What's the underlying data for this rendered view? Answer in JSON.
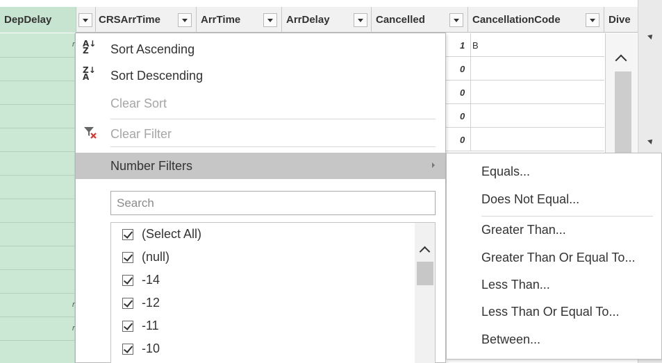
{
  "columns": [
    {
      "label": "DepDelay"
    },
    {
      "label": "CRSArrTime"
    },
    {
      "label": "ArrTime"
    },
    {
      "label": "ArrDelay"
    },
    {
      "label": "Cancelled"
    },
    {
      "label": "CancellationCode"
    },
    {
      "label": "Dive"
    }
  ],
  "grid": {
    "cancelled_values": [
      "1",
      "0",
      "0",
      "0",
      "0"
    ],
    "cancellation_codes": [
      "B",
      "",
      "",
      "",
      ""
    ],
    "depdelay_marks": [
      "r",
      "r",
      "r"
    ]
  },
  "menu": {
    "sort_ascending": "Sort Ascending",
    "sort_descending": "Sort Descending",
    "clear_sort": "Clear Sort",
    "clear_filter": "Clear Filter",
    "number_filters": "Number Filters",
    "search_placeholder": "Search",
    "checklist": [
      "(Select All)",
      "(null)",
      "-14",
      "-12",
      "-11",
      "-10"
    ]
  },
  "submenu": {
    "items": [
      "Equals...",
      "Does Not Equal...",
      "Greater Than...",
      "Greater Than Or Equal To...",
      "Less Than...",
      "Less Than Or Equal To...",
      "Between..."
    ]
  },
  "colors": {
    "key_column_green": "#cbe8d4",
    "highlight_gray": "#c6c6c6",
    "clear_filter_red_x": "#d9342b"
  }
}
